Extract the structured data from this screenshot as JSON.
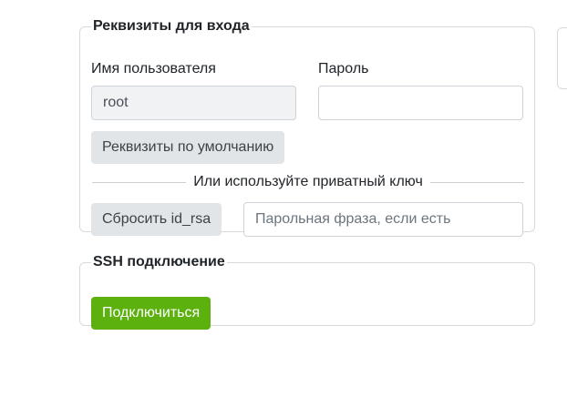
{
  "credentials": {
    "legend": "Реквизиты для входа",
    "username_label": "Имя пользователя",
    "username_value": "root",
    "password_label": "Пароль",
    "password_value": "",
    "default_button": "Реквизиты по умолчанию",
    "divider_text": "Или используйте приватный ключ",
    "reset_key_button": "Сбросить id_rsa",
    "passphrase_placeholder": "Парольная фраза, если есть"
  },
  "ssh": {
    "legend": "SSH подключение",
    "connect_button": "Подключиться"
  },
  "colors": {
    "accent_green": "#5cb10f",
    "light_button": "#e2e5e8"
  }
}
